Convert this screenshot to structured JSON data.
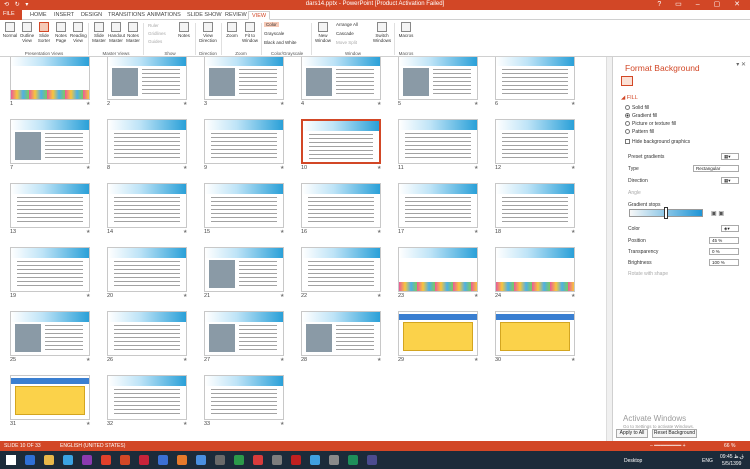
{
  "titlebar": {
    "title": "dars14.pptx - PowerPoint [Product Activation Failed]",
    "qa": "⟲ ↻ ▾",
    "win": "? ▭ – ▢ ✕"
  },
  "tabs": [
    "FILE",
    "HOME",
    "INSERT",
    "DESIGN",
    "TRANSITIONS",
    "ANIMATIONS",
    "SLIDE SHOW",
    "REVIEW",
    "VIEW"
  ],
  "active_tab": "VIEW",
  "ribbon": {
    "presentation_views": [
      "Normal",
      "Outline View",
      "Slide Sorter",
      "Notes Page",
      "Reading View"
    ],
    "master_views": [
      "Slide Master",
      "Handout Master",
      "Notes Master"
    ],
    "show": [
      "Ruler",
      "Gridlines",
      "Guides"
    ],
    "notes": "Notes",
    "view_direction": "View Direction",
    "zoom": [
      "Zoom",
      "Fit to Window"
    ],
    "color": [
      "Color",
      "Grayscale",
      "Black and White"
    ],
    "window": {
      "new": "New Window",
      "arrange": "Arrange All",
      "cascade": "Cascade",
      "move_split": "Move Split",
      "switch": "Switch Windows"
    },
    "macros": "Macros",
    "groups": {
      "pv": "Presentation Views",
      "mv": "Master Views",
      "show": "Show",
      "dir": "Direction",
      "zoom": "Zoom",
      "cg": "Color/Grayscale",
      "win": "Window",
      "mac": "Macros"
    }
  },
  "slides": [
    "1",
    "2",
    "3",
    "4",
    "5",
    "6",
    "7",
    "8",
    "9",
    "10",
    "11",
    "12",
    "13",
    "14",
    "15",
    "16",
    "17",
    "18",
    "19",
    "20",
    "21",
    "22",
    "23",
    "24",
    "25",
    "26",
    "27",
    "28",
    "29",
    "30",
    "31",
    "32",
    "33"
  ],
  "selected_slide": "10",
  "pane": {
    "title": "Format Background",
    "close": "▾ ✕",
    "section": "◢ FILL",
    "fill_options": [
      "Solid fill",
      "Gradient fill",
      "Picture or texture fill",
      "Pattern fill"
    ],
    "selected_fill": "Gradient fill",
    "hide_graphics": "Hide background graphics",
    "preset": "Preset gradients",
    "type_label": "Type",
    "type_value": "Rectangular",
    "direction": "Direction",
    "angle": "Angle",
    "stops": "Gradient stops",
    "color": "Color",
    "position": "Position",
    "position_value": "45 %",
    "transparency": "Transparency",
    "transparency_value": "0 %",
    "brightness": "Brightness",
    "brightness_value": "100 %",
    "rotate": "Rotate with shape",
    "apply_all": "Apply to All",
    "reset": "Reset Background"
  },
  "watermark": {
    "line1": "Activate Windows",
    "line2": "Go to Settings to activate Windows."
  },
  "status": {
    "slide": "SLIDE 10 OF 33",
    "lang": "ENGLISH (UNITED STATES)",
    "zoom": "66 %"
  },
  "taskbar": {
    "desktop": "Desktop",
    "lang": "ENG",
    "time": "09:45 ق.ظ",
    "date": "5/5/1399"
  }
}
